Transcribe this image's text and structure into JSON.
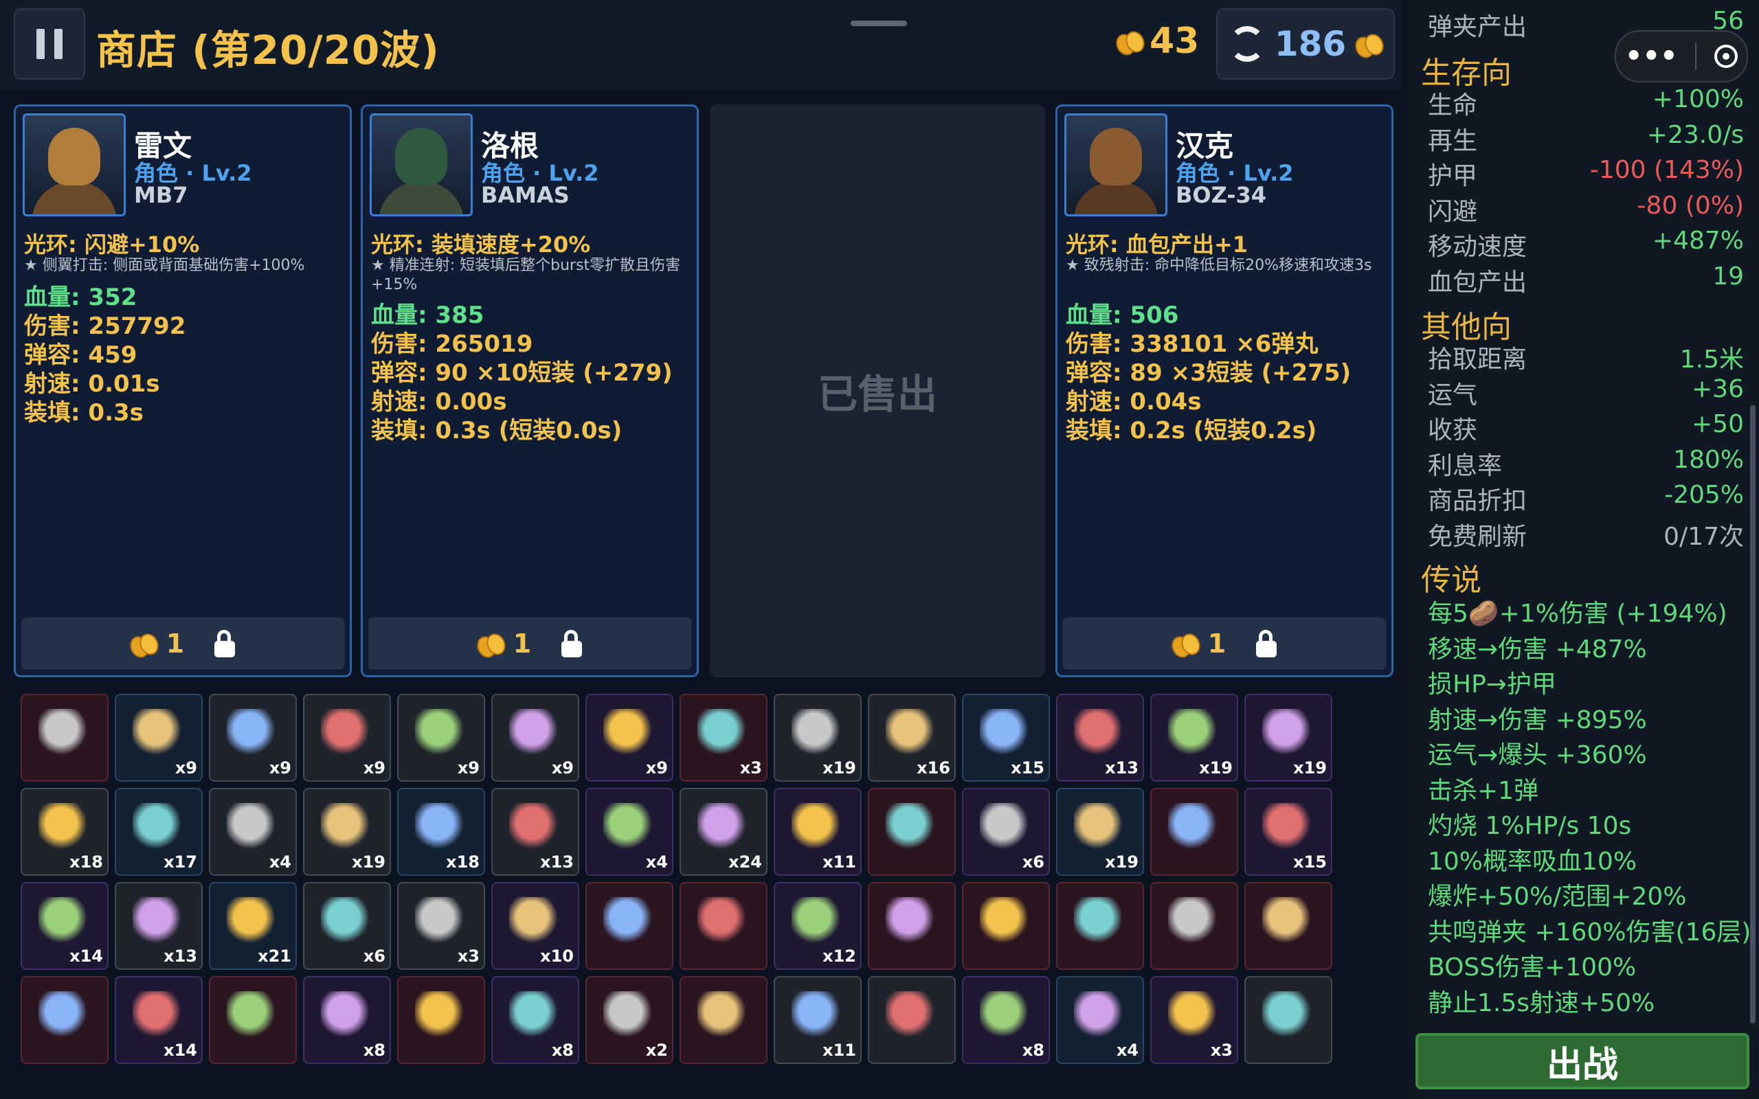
{
  "header": {
    "title": "商店 (第20/20波)",
    "coins": "43",
    "refresh_cost": "186"
  },
  "cards": [
    {
      "name": "雷文",
      "role": "角色 · Lv.2",
      "weapon": "MB7",
      "aura": "光环: 闪避+10%",
      "skill": "★ 侧翼打击: 侧面或背面基础伤害+100%",
      "stats": [
        "血量: 352",
        "伤害: 257792",
        "弹容: 459",
        "射速: 0.01s",
        "装填: 0.3s"
      ],
      "price": "1"
    },
    {
      "name": "洛根",
      "role": "角色 · Lv.2",
      "weapon": "BAMAS",
      "aura": "光环: 装填速度+20%",
      "skill": "★ 精准连射: 短装填后整个burst零扩散且伤害+15%",
      "stats": [
        "血量: 385",
        "伤害: 265019",
        "弹容: 90 ×10短装 (+279)",
        "射速: 0.00s",
        "装填: 0.3s (短装0.0s)"
      ],
      "price": "1"
    },
    {
      "name": "汉克",
      "role": "角色 · Lv.2",
      "weapon": "BOZ-34",
      "aura": "光环: 血包产出+1",
      "skill": "★ 致残射击: 命中降低目标20%移速和攻速3s",
      "stats": [
        "血量: 506",
        "伤害: 338101 ×6弹丸",
        "弹容: 89 ×3短装 (+275)",
        "射速: 0.04s",
        "装填: 0.2s (短装0.2s)"
      ],
      "price": "1"
    }
  ],
  "sold_label": "已售出",
  "inventory": [
    [
      "",
      "red"
    ],
    [
      "x9",
      "blue"
    ],
    [
      "x9",
      "gray"
    ],
    [
      "x9",
      "gray"
    ],
    [
      "x9",
      "gray"
    ],
    [
      "x9",
      "gray"
    ],
    [
      "x9",
      "purple"
    ],
    [
      "x3",
      "red"
    ],
    [
      "x19",
      "gray"
    ],
    [
      "x16",
      "gray"
    ],
    [
      "x15",
      "blue"
    ],
    [
      "x13",
      "purple"
    ],
    [
      "x19",
      "purple"
    ],
    [
      "x19",
      "purple"
    ],
    [
      "x18",
      "gray"
    ],
    [
      "x17",
      "blue"
    ],
    [
      "x4",
      "gray"
    ],
    [
      "x19",
      "gray"
    ],
    [
      "x18",
      "blue"
    ],
    [
      "x13",
      "gray"
    ],
    [
      "x4",
      "purple"
    ],
    [
      "x24",
      "gray"
    ],
    [
      "x11",
      "purple"
    ],
    [
      "",
      "red"
    ],
    [
      "x6",
      "purple"
    ],
    [
      "x19",
      "blue"
    ],
    [
      "",
      "red"
    ],
    [
      "x15",
      "purple"
    ],
    [
      "x14",
      "purple"
    ],
    [
      "x13",
      "gray"
    ],
    [
      "x21",
      "blue"
    ],
    [
      "x6",
      "gray"
    ],
    [
      "x3",
      "gray"
    ],
    [
      "x10",
      "purple"
    ],
    [
      "",
      "red"
    ],
    [
      "",
      "red"
    ],
    [
      "x12",
      "purple"
    ],
    [
      "",
      "red"
    ],
    [
      "",
      "red"
    ],
    [
      "",
      "red"
    ],
    [
      "",
      "red"
    ],
    [
      "",
      "red"
    ],
    [
      "",
      "red"
    ],
    [
      "x14",
      "purple"
    ],
    [
      "",
      "red"
    ],
    [
      "x8",
      "purple"
    ],
    [
      "",
      "red"
    ],
    [
      "x8",
      "purple"
    ],
    [
      "x2",
      "red"
    ],
    [
      "",
      "red"
    ],
    [
      "x11",
      "gray"
    ],
    [
      "",
      "gray"
    ],
    [
      "x8",
      "purple"
    ],
    [
      "x4",
      "blue"
    ],
    [
      "x3",
      "purple"
    ],
    [
      "",
      "gray"
    ]
  ],
  "sidebar": {
    "top_row": {
      "label": "弹夹产出",
      "value": "56"
    },
    "survival_title": "生存向",
    "survival": [
      {
        "label": "生命",
        "value": "+100%",
        "tone": "green"
      },
      {
        "label": "再生",
        "value": "+23.0/s",
        "tone": "green"
      },
      {
        "label": "护甲",
        "value": "-100 (143%)",
        "tone": "red"
      },
      {
        "label": "闪避",
        "value": "-80 (0%)",
        "tone": "red"
      },
      {
        "label": "移动速度",
        "value": "+487%",
        "tone": "green"
      },
      {
        "label": "血包产出",
        "value": "19",
        "tone": "green"
      }
    ],
    "other_title": "其他向",
    "other": [
      {
        "label": "拾取距离",
        "value": "1.5米",
        "tone": "green"
      },
      {
        "label": "运气",
        "value": "+36",
        "tone": "green"
      },
      {
        "label": "收获",
        "value": "+50",
        "tone": "green"
      },
      {
        "label": "利息率",
        "value": "180%",
        "tone": "green"
      },
      {
        "label": "商品折扣",
        "value": "-205%",
        "tone": "green"
      },
      {
        "label": "免费刷新",
        "value": "0/17次",
        "tone": "gray"
      }
    ],
    "legend_title": "传说",
    "legend": [
      "每5🥔+1%伤害 (+194%)",
      "移速→伤害 +487%",
      "损HP→护甲",
      "射速→伤害 +895%",
      "运气→爆头 +360%",
      "击杀+1弹",
      "灼烧 1%HP/s 10s",
      "10%概率吸血10%",
      "爆炸+50%/范围+20%",
      "共鸣弹夹 +160%伤害(16层)",
      "BOSS伤害+100%",
      "静止1.5s射速+50%"
    ],
    "fight_label": "出战"
  },
  "colors": {
    "gold": "#f2c24c",
    "green": "#5fd97a",
    "red": "#ee5a5a",
    "blue": "#4fa3ee"
  }
}
